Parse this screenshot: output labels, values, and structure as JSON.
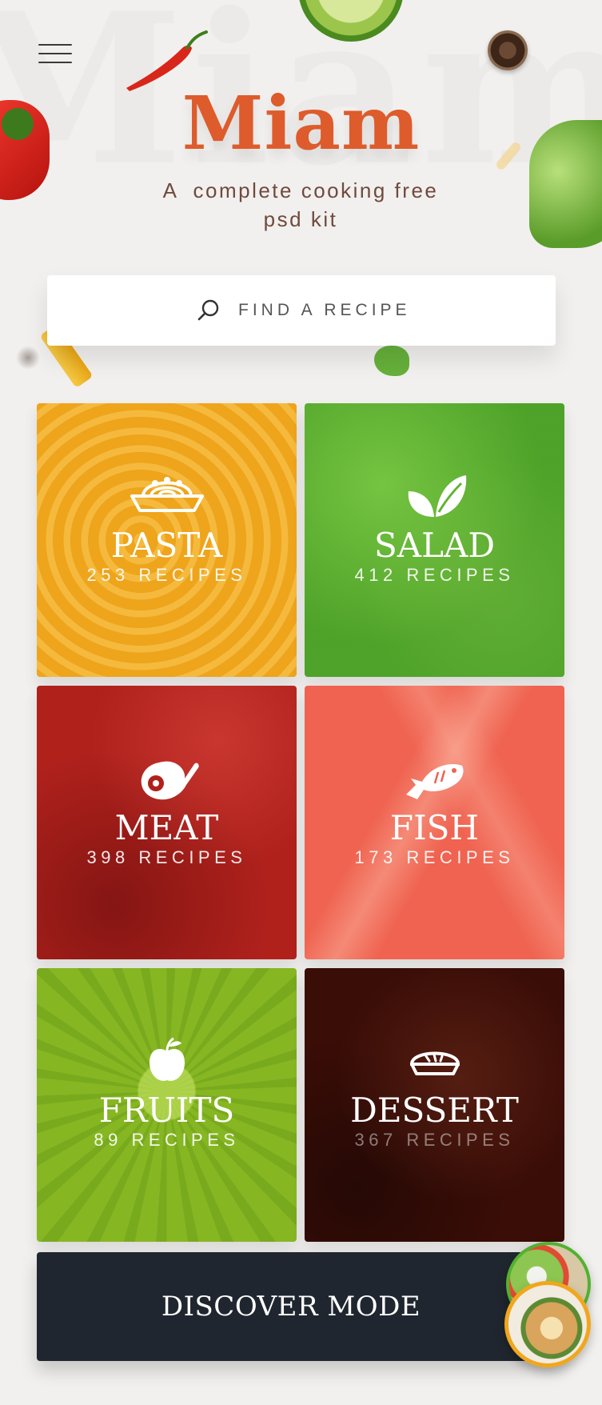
{
  "app": {
    "name": "Miam",
    "tagline": "A  complete cooking free\npsd kit"
  },
  "header": {
    "menu_icon": "hamburger-menu-icon"
  },
  "search": {
    "placeholder": "FIND A RECIPE",
    "icon": "search-icon"
  },
  "categories": [
    {
      "id": "pasta",
      "title": "PASTA",
      "count": "253 RECIPES",
      "icon": "pasta-bowl-icon",
      "color": "#f2a91f"
    },
    {
      "id": "salad",
      "title": "SALAD",
      "count": "412 RECIPES",
      "icon": "leaves-icon",
      "color": "#5fb532"
    },
    {
      "id": "meat",
      "title": "MEAT",
      "count": "398 RECIPES",
      "icon": "ham-icon",
      "color": "#b0211c"
    },
    {
      "id": "fish",
      "title": "FISH",
      "count": "173 RECIPES",
      "icon": "fish-icon",
      "color": "#ef6350"
    },
    {
      "id": "fruits",
      "title": "FRUITS",
      "count": "89 RECIPES",
      "icon": "apple-icon",
      "color": "#86b722"
    },
    {
      "id": "dessert",
      "title": "DESSERT",
      "count": "367 RECIPES",
      "icon": "pie-icon",
      "color": "#3a0d07"
    }
  ],
  "discover": {
    "label": "DISCOVER MODE"
  },
  "colors": {
    "accent": "#de5b2c",
    "tagline": "#6f4a3e",
    "discover_bg": "#20262f",
    "background": "#f1f0ee"
  }
}
